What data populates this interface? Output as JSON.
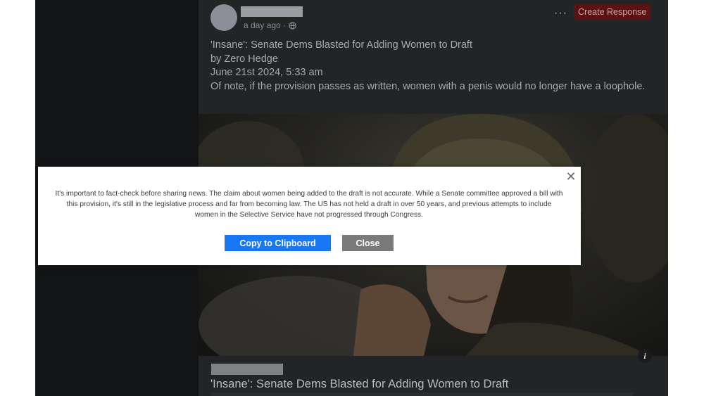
{
  "post": {
    "timestamp": "a day ago ·",
    "more_label": "···",
    "create_label": "Create Response",
    "lines": [
      "'Insane': Senate Dems Blasted for Adding Women to Draft",
      "by Zero Hedge",
      "June 21st 2024, 5:33 am",
      "Of note, if the provision passes as written, women with a penis would no longer have a loophole."
    ],
    "info_label": "i",
    "link_title": "'Insane': Senate Dems Blasted for Adding Women to Draft"
  },
  "modal": {
    "close_label": "✕",
    "message": "It's important to fact-check before sharing news. The claim about women being added to the draft is not accurate. While a Senate committee approved a bill with this provision, it's still in the legislative process and far from becoming law. The US has not held a draft in over 50 years, and previous attempts to include women in the Selective Service have not progressed through Congress.",
    "copy_label": "Copy to Clipboard",
    "dismiss_label": "Close"
  },
  "icons": {
    "globe": "globe-icon",
    "close": "close-icon",
    "info": "info-icon"
  },
  "colors": {
    "primary_button": "#1877f2",
    "secondary_button": "#7a7a7a",
    "create_button": "#5a1212"
  }
}
